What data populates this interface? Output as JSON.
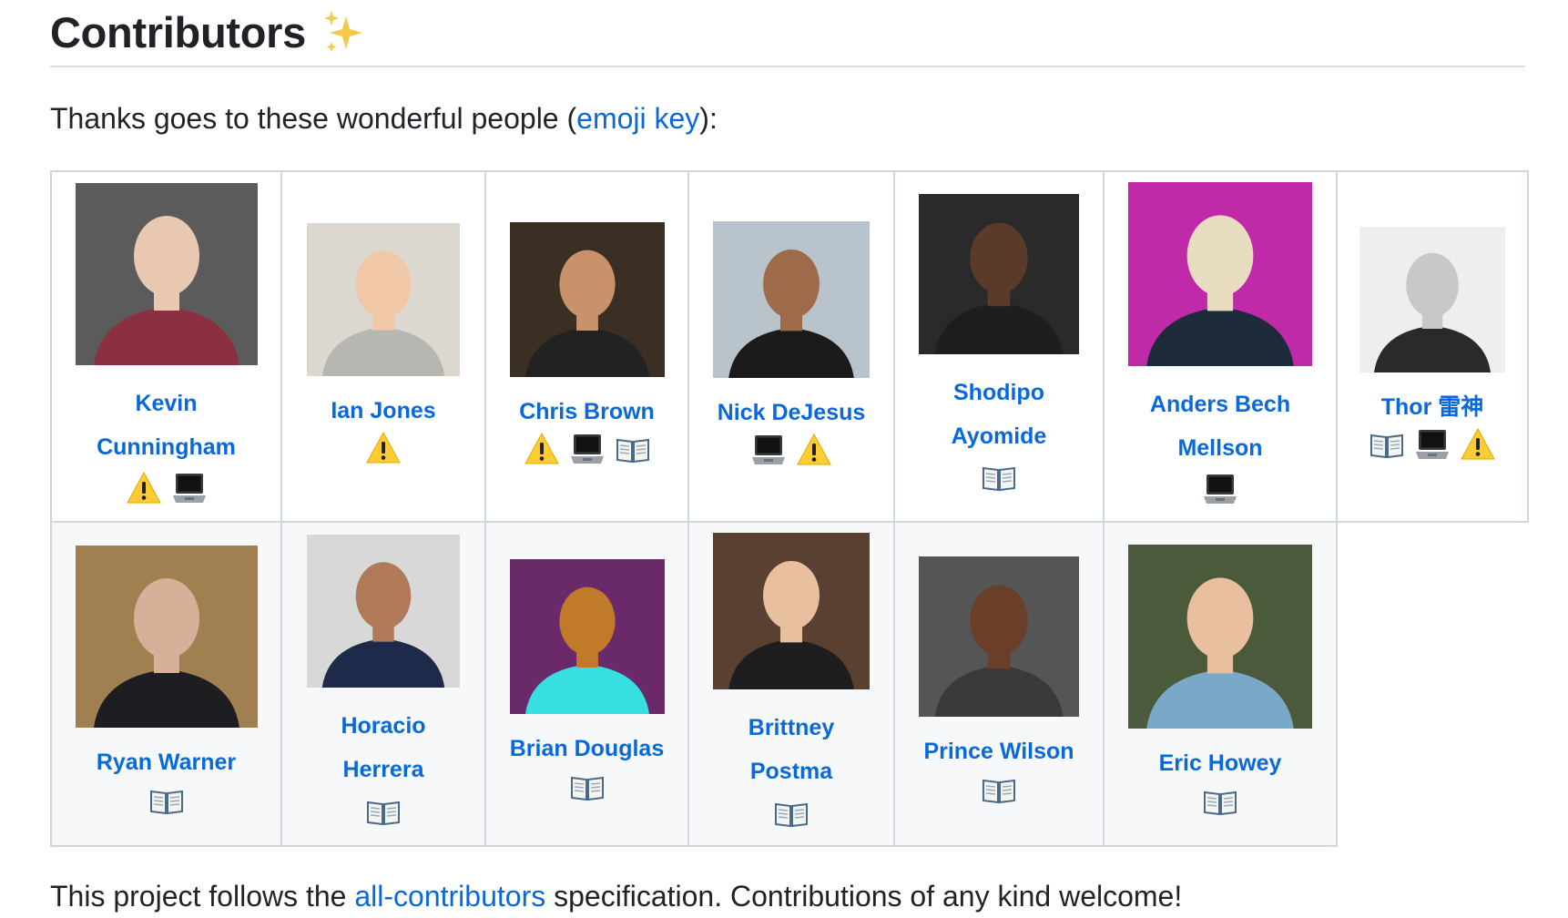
{
  "heading": {
    "title": "Contributors"
  },
  "intro": {
    "before": "Thanks goes to these wonderful people (",
    "link": "emoji key",
    "after": "):"
  },
  "contributors": [
    {
      "name_line1": "Kevin",
      "name_line2": "Cunningham",
      "badges": [
        "warning",
        "laptop"
      ]
    },
    {
      "name_line1": "Ian Jones",
      "name_line2": "",
      "badges": [
        "warning"
      ]
    },
    {
      "name_line1": "Chris Brown",
      "name_line2": "",
      "badges": [
        "warning",
        "laptop",
        "book"
      ]
    },
    {
      "name_line1": "Nick DeJesus",
      "name_line2": "",
      "badges": [
        "laptop",
        "warning"
      ]
    },
    {
      "name_line1": "Shodipo",
      "name_line2": "Ayomide",
      "badges": [
        "book"
      ]
    },
    {
      "name_line1": "Anders Bech",
      "name_line2": "Mellson",
      "badges": [
        "laptop"
      ]
    },
    {
      "name_line1": "Thor 雷神",
      "name_line2": "",
      "badges": [
        "book",
        "laptop",
        "warning"
      ]
    },
    {
      "name_line1": "Ryan Warner",
      "name_line2": "",
      "badges": [
        "book"
      ]
    },
    {
      "name_line1": "Horacio",
      "name_line2": "Herrera",
      "badges": [
        "book"
      ]
    },
    {
      "name_line1": "Brian Douglas",
      "name_line2": "",
      "badges": [
        "book"
      ]
    },
    {
      "name_line1": "Brittney",
      "name_line2": "Postma",
      "badges": [
        "book"
      ]
    },
    {
      "name_line1": "Prince Wilson",
      "name_line2": "",
      "badges": [
        "book"
      ]
    },
    {
      "name_line1": "Eric Howey",
      "name_line2": "",
      "badges": [
        "book"
      ]
    }
  ],
  "badge_icons": {
    "warning": "warning-icon",
    "laptop": "laptop-icon",
    "book": "book-icon"
  },
  "outro": {
    "before": "This project follows the ",
    "link": "all-contributors",
    "after": " specification. Contributions of any kind welcome!"
  },
  "colors": {
    "link": "#0969da",
    "border": "#d0d7de",
    "text": "#1f2328"
  }
}
